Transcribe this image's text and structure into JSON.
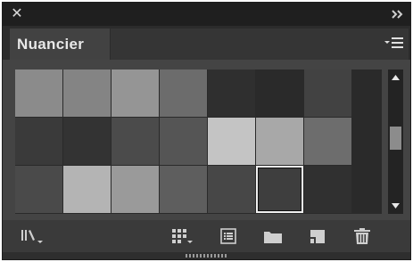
{
  "window": {
    "close_icon_glyph": "✕",
    "collapse_icon": "double-chevron-right-icon"
  },
  "tab": {
    "label": "Nuancier"
  },
  "panel_menu_icon": "panel-menu-icon",
  "swatches": {
    "rows": [
      [
        "#8b8b8b",
        "#848484",
        "#959595",
        "#6c6c6c",
        "#2f2f2f",
        "#2a2a2a",
        "#424242"
      ],
      [
        "#3a3a3a",
        "#333333",
        "#4b4b4b",
        "#555555",
        "#c4c4c4",
        "#a8a8a8",
        "#6d6d6d"
      ],
      [
        "#4a4a4a",
        "#b4b4b4",
        "#9a9a9a",
        "#5e5e5e",
        "#474747",
        "#3e3e3e",
        "#303030"
      ]
    ],
    "selected": {
      "row": 2,
      "col": 5
    }
  },
  "colors": {
    "panel_bg": "#3a3a3a",
    "title_bg": "#1f1f1f",
    "tab_active_bg": "#424242",
    "icon": "#cfcfcf",
    "selection_border": "#f0f0f0"
  },
  "toolbar": {
    "items": [
      "swatch-libraries-menu-icon",
      "show-swatch-kinds-menu-icon",
      "swatch-options-icon",
      "new-color-group-icon",
      "new-swatch-icon",
      "delete-swatch-icon"
    ]
  }
}
